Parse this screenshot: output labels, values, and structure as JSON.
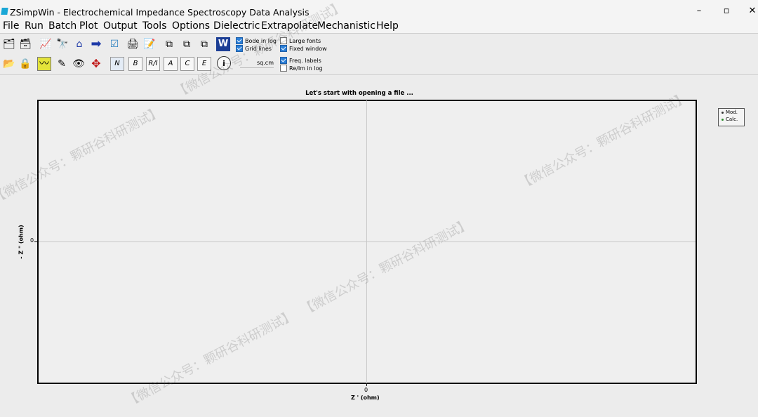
{
  "window": {
    "title": "ZSimpWin - Electrochemical Impedance Spectroscopy Data Analysis",
    "controls": {
      "minimize": "–",
      "maximize": "▫",
      "close": "✕"
    }
  },
  "menu": {
    "items": [
      "File",
      "Run",
      "Batch",
      "Plot",
      "Output",
      "Tools",
      "Options",
      "Dielectric",
      "Extrapolate",
      "Mechanistic",
      "Help"
    ]
  },
  "toolbar": {
    "row1_icons": [
      "open-files-icon",
      "save-files-icon",
      "fit-curve-icon",
      "binoculars-icon",
      "home-icon",
      "arrow-right-icon",
      "check-chart-icon",
      "print-icon",
      "notes-icon",
      "copy-icon",
      "copy-plot-icon",
      "copy-data-icon"
    ],
    "row2_icons": [
      "open-folder-icon",
      "lock-icon",
      "chart-yellow-icon",
      "pencil-chart-icon",
      "eye-icon",
      "move-arrows-icon"
    ],
    "plot_buttons": [
      "N",
      "B",
      "R/I",
      "A",
      "C",
      "E"
    ],
    "word_label": "W",
    "info_label": "i",
    "area_unit": "sq.cm",
    "options": [
      {
        "label": "Bode in log",
        "checked": true
      },
      {
        "label": "Grid lines",
        "checked": true
      },
      {
        "label": "Large fonts",
        "checked": false
      },
      {
        "label": "Fixed window",
        "checked": true
      },
      {
        "label": "Freq. labels",
        "checked": true
      },
      {
        "label": "Re/Im in log",
        "checked": false
      }
    ]
  },
  "plot": {
    "title": "Let's start with opening a file ...",
    "xlabel": "Z ' (ohm)",
    "ylabel": "- Z \" (ohm)",
    "x_tick": "0",
    "y_tick": "0"
  },
  "legend": {
    "items": [
      {
        "label": "Mod.",
        "color": "#333333"
      },
      {
        "label": "Calc.",
        "color": "#2a8c2a"
      }
    ]
  },
  "watermark": "【微信公众号：颗研谷科研测试】"
}
